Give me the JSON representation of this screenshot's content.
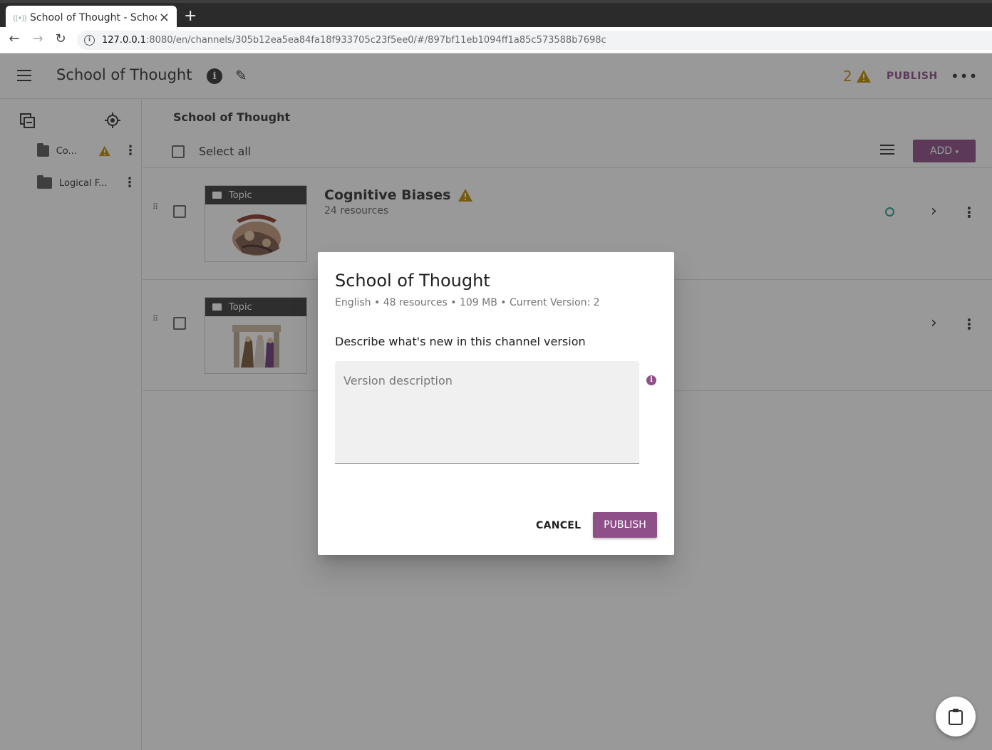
{
  "browser": {
    "tab_title": "School of Thought - School of Thought",
    "url_host": "127.0.0.1",
    "url_path": ":8080/en/channels/305b12ea5ea84fa18f933705c23f5ee0/#/897bf11eb1094ff1a85c573588b7698c"
  },
  "toolbar": {
    "title": "School of Thought",
    "warning_count": "2",
    "publish_label": "PUBLISH"
  },
  "sidebar": {
    "items": [
      {
        "label": "Co...",
        "has_warning": true
      },
      {
        "label": "Logical F...",
        "has_warning": false
      }
    ]
  },
  "main": {
    "heading": "School of Thought",
    "select_all_label": "Select all",
    "add_label": "ADD",
    "nodes": [
      {
        "kind": "Topic",
        "title": "Cognitive Biases",
        "subtitle": "24 resources",
        "has_warning": true
      },
      {
        "kind": "Topic",
        "title": "",
        "subtitle": "",
        "has_warning": false
      }
    ]
  },
  "dialog": {
    "title": "School of Thought",
    "meta": "English • 48 resources • 109 MB • Current Version: 2",
    "prompt": "Describe what's new in this channel version",
    "field_placeholder": "Version description",
    "field_value": "",
    "cancel_label": "CANCEL",
    "publish_label": "PUBLISH"
  },
  "colors": {
    "accent": "#8f4f89",
    "warning": "#c18f00",
    "status": "#2a9d8f"
  }
}
